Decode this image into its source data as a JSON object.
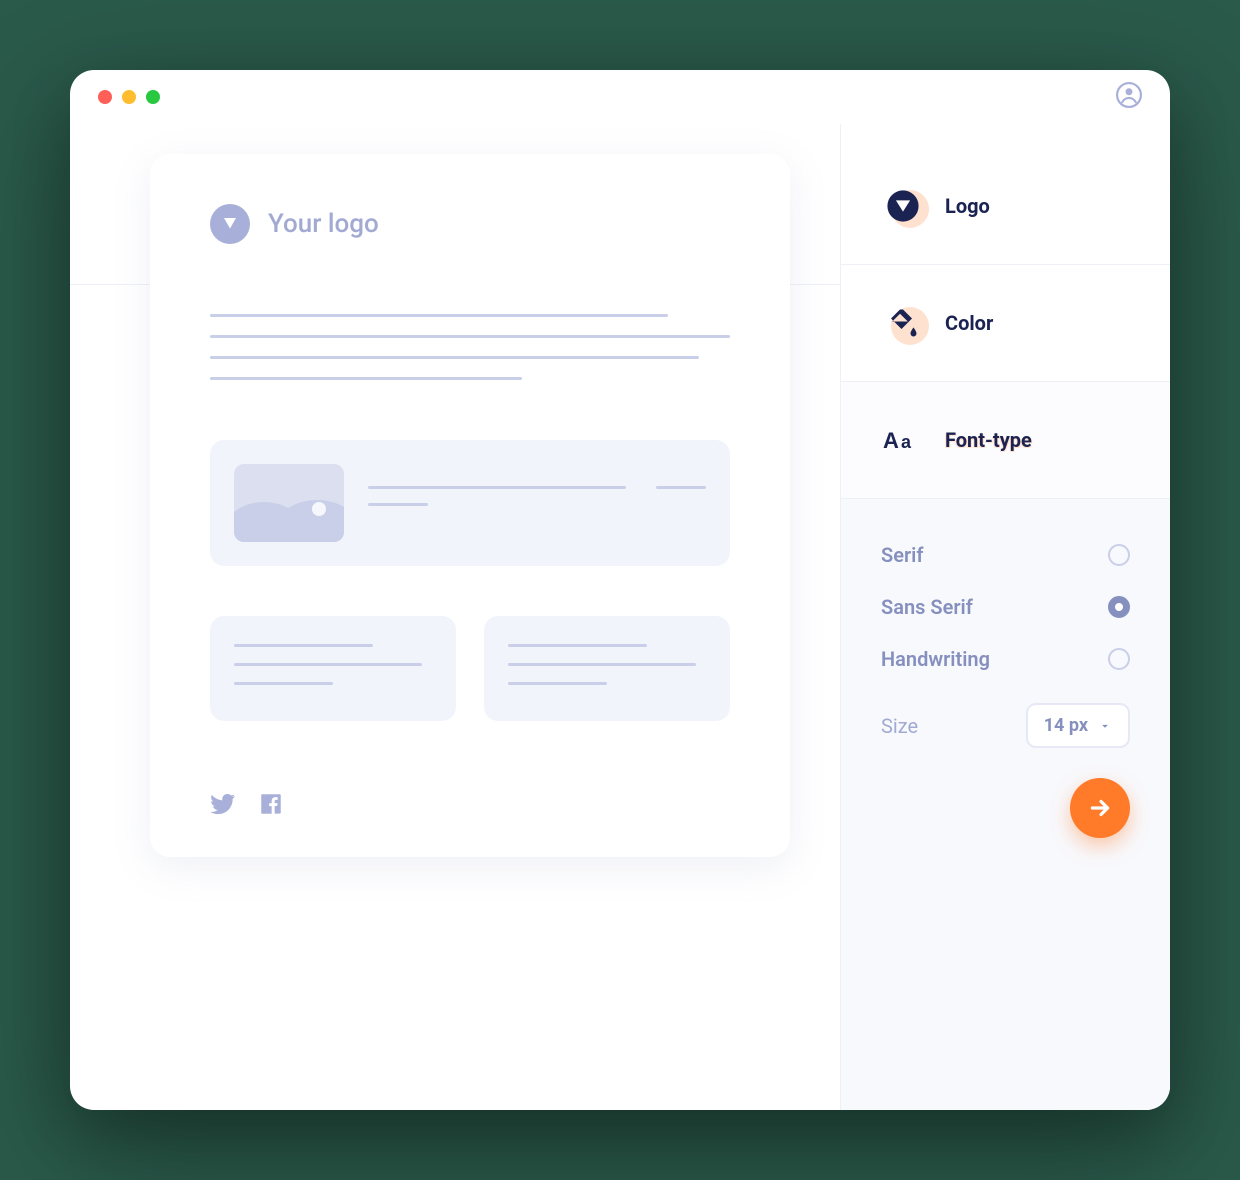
{
  "canvas": {
    "logo_label": "Your logo"
  },
  "panel": {
    "sections": [
      {
        "label": "Logo"
      },
      {
        "label": "Color"
      },
      {
        "label": "Font-type"
      }
    ]
  },
  "font_options": {
    "items": [
      {
        "label": "Serif",
        "selected": false
      },
      {
        "label": "Sans Serif",
        "selected": true
      },
      {
        "label": "Handwriting",
        "selected": false
      }
    ],
    "size_label": "Size",
    "size_value": "14 px"
  },
  "colors": {
    "accent": "#ff7a29",
    "navy": "#1a2352",
    "muted": "#a8b0d9"
  }
}
